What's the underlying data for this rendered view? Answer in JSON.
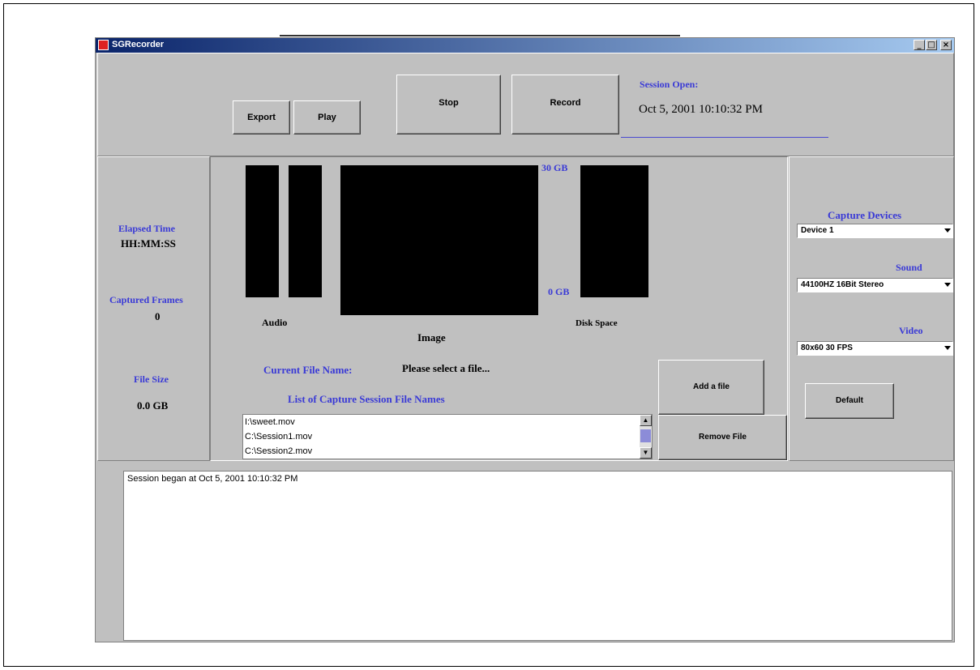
{
  "window": {
    "title": "SGRecorder",
    "controls": {
      "minimize": "_",
      "maximize": "□",
      "close": "×"
    }
  },
  "toolbar": {
    "export_label": "Export",
    "play_label": "Play",
    "stop_label": "Stop",
    "record_label": "Record"
  },
  "session": {
    "heading": "Session Open:",
    "date": "Oct 5, 2001 10:10:32 PM"
  },
  "stats": {
    "elapsed_label": "Elapsed Time",
    "elapsed_value": "HH:MM:SS",
    "frames_label": "Captured Frames",
    "frames_value": "0",
    "size_label": "File Size",
    "size_value": "0.0 GB"
  },
  "meters": {
    "audio_label": "Audio",
    "image_label": "Image",
    "disk_label": "Disk Space",
    "disk_max": "30 GB",
    "disk_min": "0 GB"
  },
  "file": {
    "current_label": "Current File Name:",
    "current_value": "Please select a file...",
    "list_heading": "List of Capture Session File Names",
    "items": [
      "I:\\sweet.mov",
      "C:\\Session1.mov",
      "C:\\Session2.mov"
    ],
    "add_label": "Add a file",
    "remove_label": "Remove File"
  },
  "devices": {
    "capture_label": "Capture Devices",
    "capture_value": "Device 1",
    "sound_label": "Sound",
    "sound_value": "44100HZ 16Bit Stereo",
    "video_label": "Video",
    "video_value": "80x60 30 FPS",
    "default_label": "Default"
  },
  "log": {
    "text": "Session began at Oct 5, 2001 10:10:32 PM"
  },
  "colors": {
    "accent_blue": "#3a3ad6",
    "titlebar": "#0a246a"
  }
}
